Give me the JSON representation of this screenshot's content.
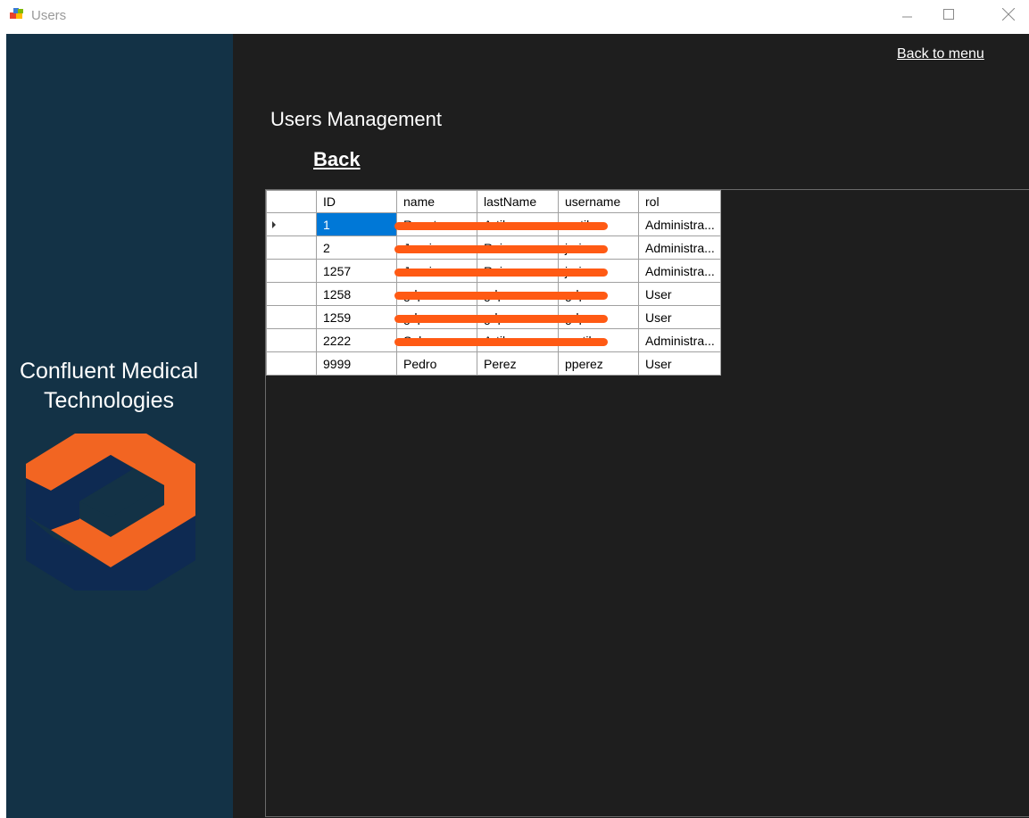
{
  "window": {
    "title": "Users"
  },
  "sidebar": {
    "company_line1": "Confluent Medical",
    "company_line2": "Technologies",
    "background_color": "#133246",
    "logo_colors": {
      "orange": "#f26522",
      "navy": "#0e2a52"
    }
  },
  "header": {
    "back_to_menu": "Back to menu",
    "page_title": "Users Management",
    "back": "Back"
  },
  "grid": {
    "columns": [
      "ID",
      "name",
      "lastName",
      "username",
      "rol"
    ],
    "rows": [
      {
        "id": "1",
        "name": "Renato",
        "lastName": "Artiles",
        "username": "rartiles",
        "rol": "Administra...",
        "selected": true
      },
      {
        "id": "2",
        "name": "Jessie",
        "lastName": "Ruiz",
        "username": "jruiz",
        "rol": "Administra..."
      },
      {
        "id": "1257",
        "name": "Jessie",
        "lastName": "Ruiz",
        "username": "jruiz",
        "rol": "Administra..."
      },
      {
        "id": "1258",
        "name": "gdp",
        "lastName": "gdp",
        "username": "gdp",
        "rol": "User"
      },
      {
        "id": "1259",
        "name": "gdp",
        "lastName": "gdp",
        "username": "gdp",
        "rol": "User"
      },
      {
        "id": "2222",
        "name": "Sahara",
        "lastName": "Artiles",
        "username": "sartiles",
        "rol": "Administra..."
      },
      {
        "id": "9999",
        "name": "Pedro",
        "lastName": "Perez",
        "username": "pperez",
        "rol": "User"
      }
    ],
    "selection_color": "#0078d7",
    "redaction_color": "#ff5a14"
  }
}
